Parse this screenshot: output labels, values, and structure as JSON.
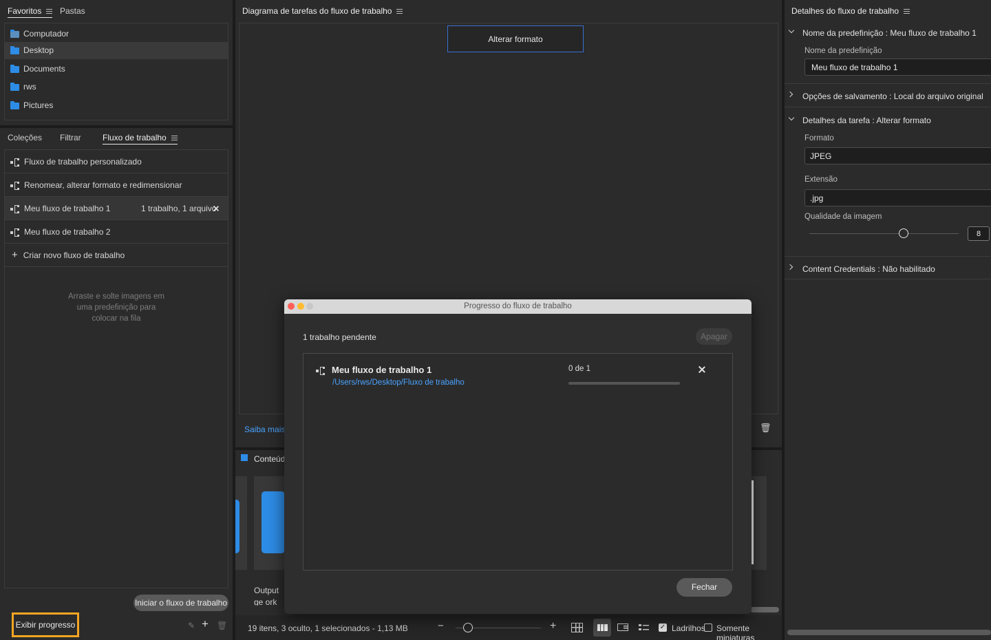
{
  "favorites": {
    "tabs": [
      "Favoritos",
      "Pastas"
    ],
    "items": [
      {
        "label": "Computador",
        "icon": "computer-icon"
      },
      {
        "label": "Desktop",
        "icon": "folder-icon"
      },
      {
        "label": "Documents",
        "icon": "folder-icon"
      },
      {
        "label": "rws",
        "icon": "folder-icon"
      },
      {
        "label": "Pictures",
        "icon": "folder-icon"
      }
    ]
  },
  "workflow_panel": {
    "tabs": [
      "Coleções",
      "Filtrar",
      "Fluxo de trabalho"
    ],
    "items": [
      {
        "label": "Fluxo de trabalho personalizado",
        "meta": ""
      },
      {
        "label": "Renomear, alterar formato e redimensionar",
        "meta": ""
      },
      {
        "label": "Meu fluxo de trabalho 1",
        "meta": "1 trabalho, 1 arquivo"
      },
      {
        "label": "Meu fluxo de trabalho 2",
        "meta": ""
      }
    ],
    "create_label": "Criar novo fluxo de trabalho",
    "drop_hint": "Arraste e solte imagens em uma predefinição para colocar na fila",
    "start_button": "Iniciar o fluxo de trabalho",
    "show_progress": "Exibir progresso"
  },
  "diagram": {
    "title": "Diagrama de tarefas do fluxo de trabalho",
    "node_label": "Alterar formato",
    "learn_more": "Saiba mais"
  },
  "content": {
    "title": "Conteúdo:",
    "thumb_caption": "Output ge ork",
    "status": "19 itens, 3 oculto, 1 selecionados - 1,13 MB",
    "tiles_label": "Ladrilhos",
    "thumbs_only_label": "Somente miniaturas",
    "tiles_checked": true,
    "thumbs_only_checked": false
  },
  "details": {
    "title": "Detalhes do fluxo de trabalho",
    "preset_section": "Nome da predefinição : Meu fluxo de trabalho 1",
    "preset_label": "Nome da predefinição",
    "preset_value": "Meu fluxo de trabalho 1",
    "save_section": "Opções de salvamento : Local do arquivo original",
    "task_section": "Detalhes da tarefa : Alterar formato",
    "format_label": "Formato",
    "format_value": "JPEG",
    "extension_label": "Extensão",
    "extension_value": ".jpg",
    "quality_label": "Qualidade da imagem",
    "quality_value": "8",
    "quality_fraction": 0.63,
    "credentials_section": "Content Credentials : Não habilitado"
  },
  "dialog": {
    "title": "Progresso do fluxo de trabalho",
    "pending": "1 trabalho pendente",
    "clear_button": "Apagar",
    "job_name": "Meu fluxo de trabalho 1",
    "job_path": "/Users/rws/Desktop/Fluxo de trabalho",
    "job_count": "0 de 1",
    "progress_fraction": 0,
    "close_button": "Fechar"
  },
  "colors": {
    "accent_blue": "#2d8ce6",
    "highlight_orange": "#f5a623",
    "link_blue": "#4aa3ff"
  }
}
